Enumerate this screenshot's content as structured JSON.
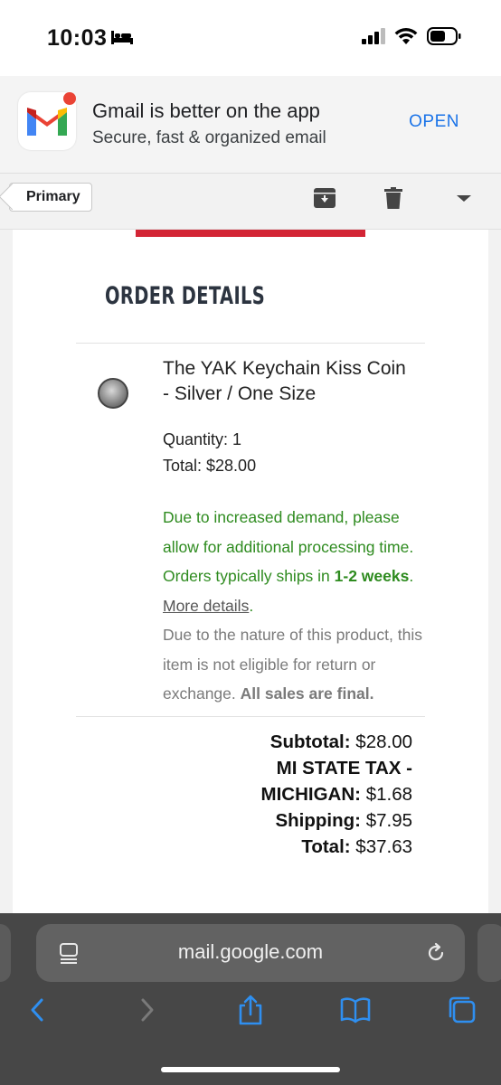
{
  "status_bar": {
    "time": "10:03"
  },
  "app_banner": {
    "title": "Gmail is better on the app",
    "subtitle": "Secure, fast & organized email",
    "open_label": "OPEN"
  },
  "toolbar": {
    "back_label": "Primary"
  },
  "email": {
    "section_title": "ORDER DETAILS",
    "item": {
      "name": "The YAK Keychain Kiss Coin - Silver / One Size",
      "quantity": "Quantity: 1",
      "total": "Total: $28.00"
    },
    "notice": {
      "green_text": "Due to increased demand, please allow for additional processing time. Orders typically ships in ",
      "green_bold": "1-2 weeks",
      "green_after": ". ",
      "link": "More details",
      "link_after": ".",
      "gray_text": "Due to the nature of this product, this item is not eligible for return or exchange. ",
      "gray_bold": "All sales are final."
    },
    "summary": {
      "subtotal_label": "Subtotal:",
      "subtotal_value": " $28.00",
      "tax_label_1": "MI STATE TAX -",
      "tax_label_2": "MICHIGAN:",
      "tax_value": " $1.68",
      "shipping_label": "Shipping:",
      "shipping_value": " $7.95",
      "total_label": "Total:",
      "total_value": " $37.63"
    }
  },
  "browser": {
    "url": "mail.google.com"
  },
  "colors": {
    "accent_blue": "#1a73e8",
    "red_bar": "#d32535",
    "notice_green": "#2e8b1f",
    "safari_icon_blue": "#2f8ff0"
  }
}
